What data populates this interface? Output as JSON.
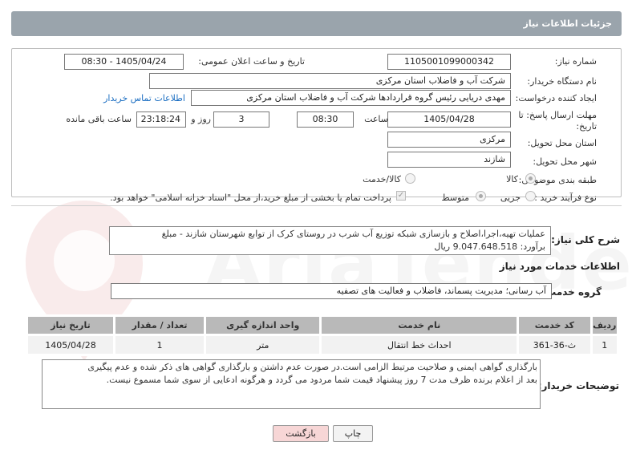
{
  "header": {
    "title": "جزئیات اطلاعات نیاز"
  },
  "form": {
    "need_number_label": "شماره نیاز:",
    "need_number": "1105001099000342",
    "announce_label": "تاریخ و ساعت اعلان عمومی:",
    "announce_value": "1405/04/24 - 08:30",
    "buyer_org_label": "نام دستگاه خریدار:",
    "buyer_org": "شرکت آب و فاضلاب استان مرکزی",
    "creator_label": "ایجاد کننده درخواست:",
    "creator": "مهدی دریایی رئیس گروه قراردادها شرکت آب و فاضلاب استان مرکزی",
    "contact_link": "اطلاعات تماس خریدار",
    "deadline_label_1": "مهلت ارسال پاسخ: تا",
    "deadline_label_2": "تاریخ:",
    "deadline_date": "1405/04/28",
    "time_label": "ساعت",
    "deadline_time": "08:30",
    "days_value": "3",
    "days_label": "روز و",
    "remaining_time": "23:18:24",
    "remaining_label": "ساعت باقی مانده",
    "province_label": "استان محل تحویل:",
    "province": "مرکزی",
    "city_label": "شهر محل تحویل:",
    "city": "شازند",
    "category_label": "طبقه بندی موضوعی:",
    "category_options": [
      "کالا",
      "کالا/خدمت"
    ],
    "process_label": "نوع فرآیند خرید :",
    "process_options": [
      "جزیی",
      "متوسط"
    ],
    "payment_note": "پرداخت تمام یا بخشی از مبلغ خرید،از محل \"اسناد خزانه اسلامی\" خواهد بود."
  },
  "summary": {
    "label": "شرح کلی نیاز:",
    "text_line1": "عملیات تهیه،اجرا،اصلاح  و بازسازی  شبکه توزیع  آب شرب در روستای کرک از توابع شهرستان شازند - مبلغ",
    "text_line2": "برآورد: 9.047.648.518 ریال"
  },
  "services": {
    "section_title": "اطلاعات خدمات مورد نیاز",
    "group_label": "گروه خدمت:",
    "group_value": "آب رسانی؛ مدیریت پسماند، فاضلاب و فعالیت های تصفیه",
    "columns": [
      "ردیف",
      "کد خدمت",
      "نام خدمت",
      "واحد اندازه گیری",
      "تعداد / مقدار",
      "تاریخ نیاز"
    ],
    "rows": [
      [
        "1",
        "ث-36-361",
        "احداث خط انتقال",
        "متر",
        "1",
        "1405/04/28"
      ]
    ]
  },
  "buyer_notes": {
    "label": "توضیحات خریدار:",
    "line1": "بارگذاری گواهی ایمنی و صلاحیت مرتبط الزامی است.در صورت عدم داشتن و بارگذاری گواهی های ذکر شده و عدم پیگیری",
    "line2": "بعد از اعلام برنده ظرف مدت 7 روز پیشنهاد قیمت شما مردود می گردد و هرگونه ادعایی از سوی شما مسموع نیست."
  },
  "buttons": {
    "print": "چاپ",
    "back": "بازگشت"
  },
  "watermark": "AriaTender.net",
  "colors": {
    "header": "#9aa4ac",
    "link": "#1b6ec2",
    "back_button": "#f7d6d6"
  }
}
